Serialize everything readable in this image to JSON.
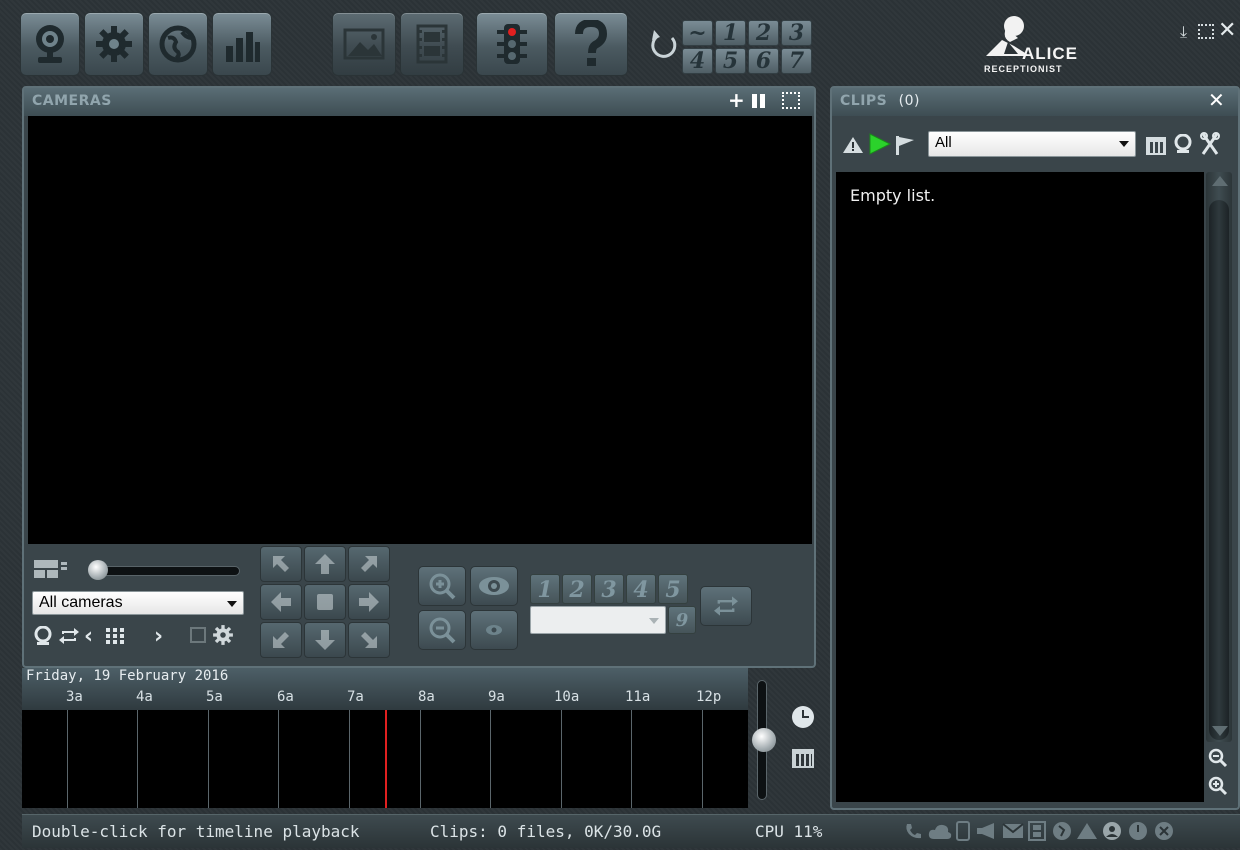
{
  "toolbar": {
    "buttons": [
      {
        "name": "webcam-icon"
      },
      {
        "name": "gear-icon"
      },
      {
        "name": "globe-icon"
      },
      {
        "name": "bar-chart-icon"
      },
      {
        "name": "picture-icon"
      },
      {
        "name": "film-icon"
      },
      {
        "name": "traffic-light-icon"
      },
      {
        "name": "help-icon"
      }
    ],
    "layouts": {
      "row1": [
        "~",
        "1",
        "2",
        "3"
      ],
      "row2": [
        "4",
        "5",
        "6",
        "7"
      ]
    },
    "logo_text": "ALICE",
    "logo_sub": "RECEPTIONIST"
  },
  "cameras": {
    "title": "CAMERAS",
    "select_value": "All cameras",
    "presets": [
      "1",
      "2",
      "3",
      "4",
      "5"
    ],
    "preset_extra": "9"
  },
  "timeline": {
    "date": "Friday, 19 February 2016",
    "hours": [
      "3a",
      "4a",
      "5a",
      "6a",
      "7a",
      "8a",
      "9a",
      "10a",
      "11a",
      "12p"
    ]
  },
  "clips": {
    "title": "CLIPS",
    "count": "(0)",
    "filter_value": "All",
    "empty_text": "Empty list."
  },
  "status": {
    "hint": "Double-click for timeline playback",
    "clips_info": "Clips: 0 files, 0K/30.0G",
    "cpu": "CPU 11%"
  },
  "colors": {
    "accent_green": "#2bd22b",
    "timeline_marker": "#e02020"
  }
}
